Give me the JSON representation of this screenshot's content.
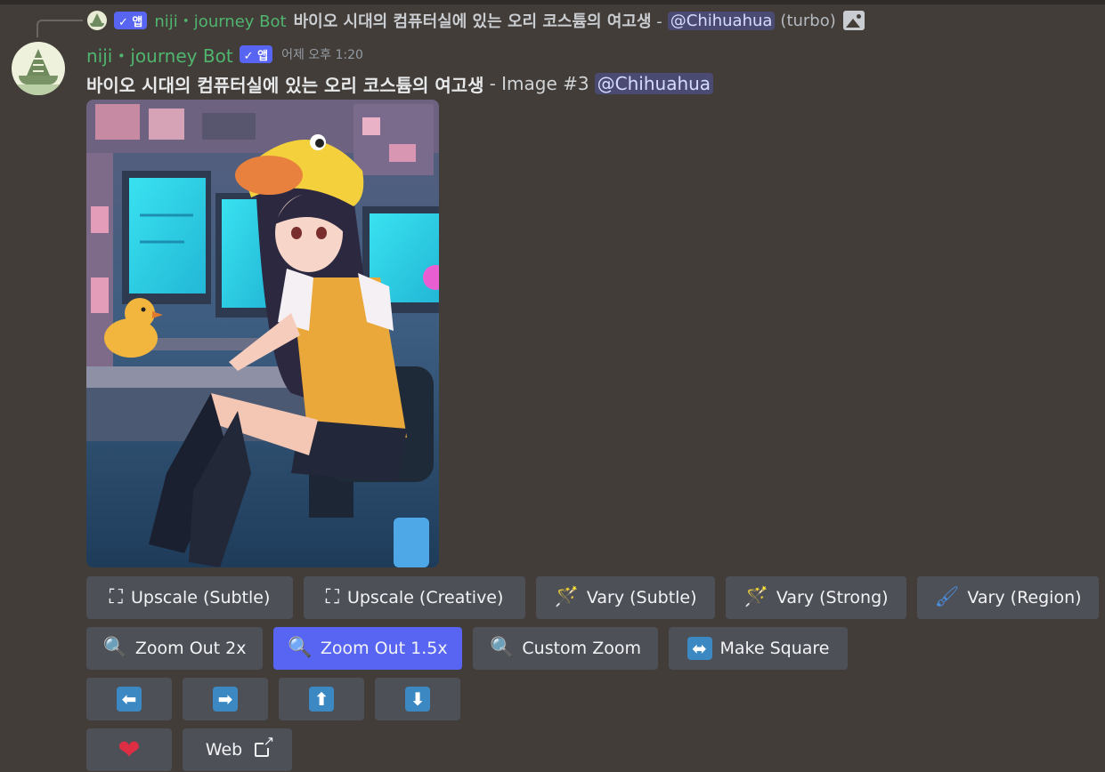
{
  "reply": {
    "app_badge": "✓ 앱",
    "author": "niji・journey Bot",
    "text": "바이오 시대의 컴퓨터실에 있는 오리 코스튬의 여고생",
    "separator": "-",
    "mention": "@Chihuahua",
    "suffix": "(turbo)",
    "attachment_icon": "image-icon"
  },
  "message": {
    "author": "niji・journey Bot",
    "app_badge": "✓ 앱",
    "timestamp": "어제 오후 1:20",
    "prompt": "바이오 시대의 컴퓨터실에 있는 오리 코스튬의 여고생",
    "suffix": "- Image #3",
    "mention": "@Chihuahua"
  },
  "buttons": {
    "row1": [
      {
        "label": "Upscale (Subtle)",
        "icon": "upscale-icon",
        "glyph": "⛶"
      },
      {
        "label": "Upscale (Creative)",
        "icon": "upscale-icon",
        "glyph": "⛶"
      },
      {
        "label": "Vary (Subtle)",
        "icon": "magic-wand-icon",
        "glyph": "🪄"
      },
      {
        "label": "Vary (Strong)",
        "icon": "magic-wand-icon",
        "glyph": "🪄"
      },
      {
        "label": "Vary (Region)",
        "icon": "paintbrush-icon",
        "glyph": "🖌"
      }
    ],
    "row2": [
      {
        "label": "Zoom Out 2x",
        "icon": "magnifier-icon",
        "glyph": "🔍"
      },
      {
        "label": "Zoom Out 1.5x",
        "icon": "magnifier-icon",
        "glyph": "🔍"
      },
      {
        "label": "Custom Zoom",
        "icon": "magnifier-icon",
        "glyph": "🔍"
      },
      {
        "label": "Make Square",
        "icon": "left-right-arrow-icon",
        "glyph": "⬌"
      }
    ],
    "pan": [
      {
        "icon": "arrow-left-icon",
        "glyph": "⬅"
      },
      {
        "icon": "arrow-right-icon",
        "glyph": "➡"
      },
      {
        "icon": "arrow-up-icon",
        "glyph": "⬆"
      },
      {
        "icon": "arrow-down-icon",
        "glyph": "⬇"
      }
    ],
    "favorite": {
      "icon": "heart-icon",
      "glyph": "❤"
    },
    "web": {
      "label": "Web",
      "icon": "external-link-icon"
    }
  },
  "colors": {
    "background": "#423d38",
    "author_green": "#4fb56f",
    "primary_button": "#5865f2",
    "secondary_button": "#4e5058",
    "mention_bg": "#4b4a72"
  }
}
